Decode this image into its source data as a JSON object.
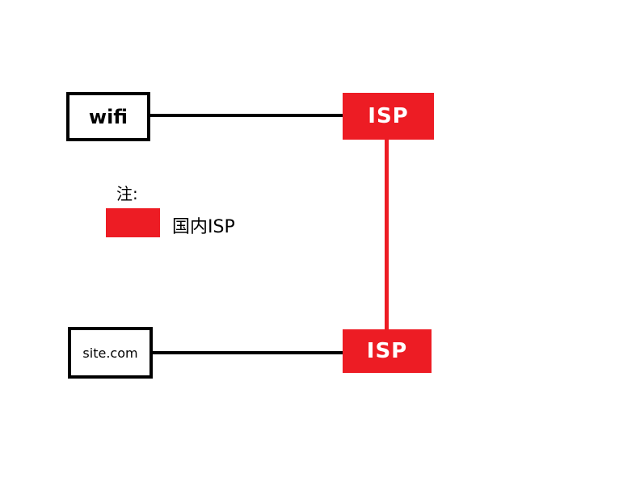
{
  "diagram": {
    "nodes": {
      "wifi": {
        "label": "wifi"
      },
      "isp_top": {
        "label": "ISP"
      },
      "site": {
        "label": "site.com"
      },
      "isp_bottom": {
        "label": "ISP"
      }
    },
    "legend": {
      "heading": "注:",
      "entries": [
        {
          "label": "国内ISP",
          "color": "#ed1c24"
        }
      ]
    },
    "colors": {
      "isp": "#ed1c24",
      "link": "#000000",
      "isp_link": "#ed1c24"
    }
  }
}
